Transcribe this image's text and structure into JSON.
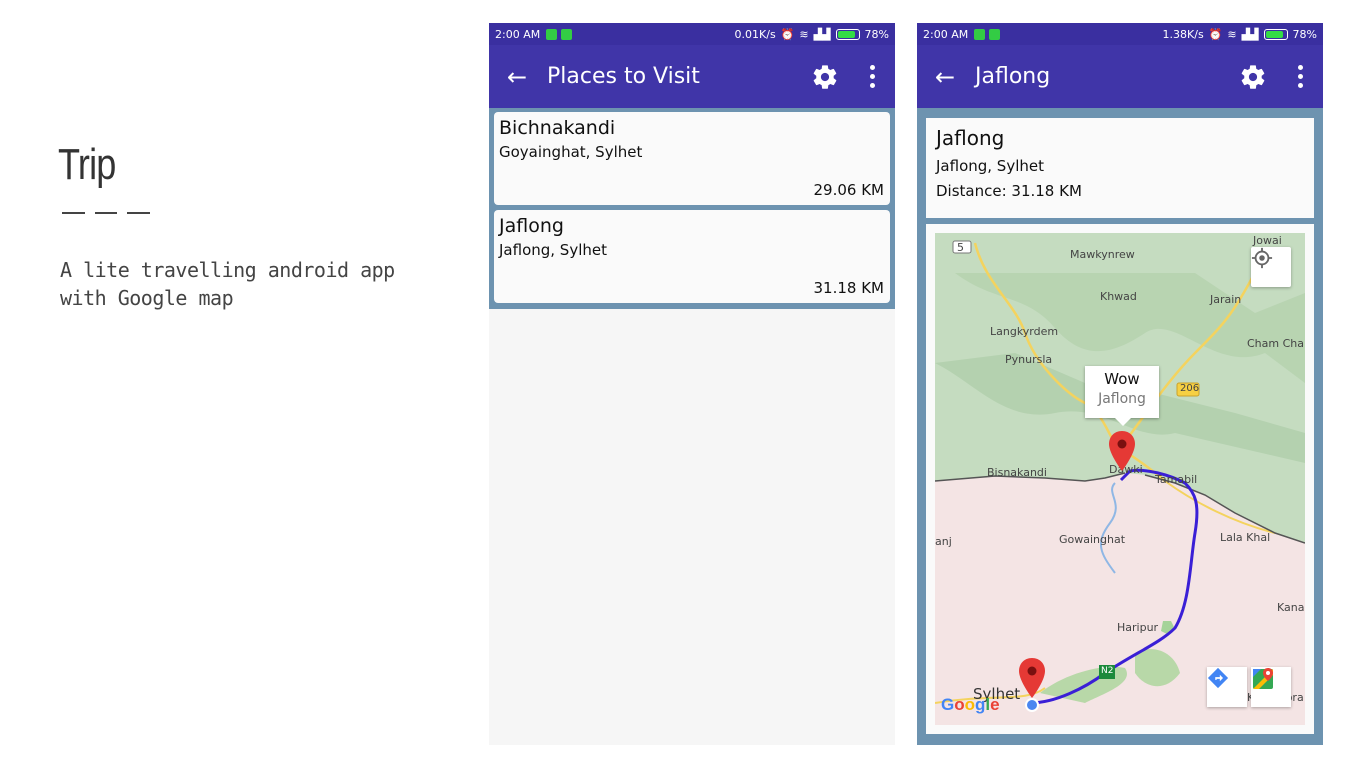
{
  "intro": {
    "title": "Trip",
    "description": "A lite travelling android app with Google map"
  },
  "phone1": {
    "status": {
      "time": "2:00 AM",
      "speed": "0.01K/s",
      "battery": "78%"
    },
    "appbar": {
      "title": "Places to Visit"
    },
    "places": [
      {
        "name": "Bichnakandi",
        "address": "Goyainghat, Sylhet",
        "distance": "29.06 KM"
      },
      {
        "name": "Jaflong",
        "address": "Jaflong, Sylhet",
        "distance": "31.18 KM"
      }
    ]
  },
  "phone2": {
    "status": {
      "time": "2:00 AM",
      "speed": "1.38K/s",
      "battery": "78%"
    },
    "appbar": {
      "title": "Jaflong"
    },
    "detail": {
      "name": "Jaflong",
      "address": "Jaflong, Sylhet",
      "distance": "Distance: 31.18 KM"
    },
    "map": {
      "info_title": "Wow",
      "info_subtitle": "Jaflong",
      "labels": {
        "road5": "5",
        "mawkynrew": "Mawkynrew",
        "jowai": "Jowai",
        "khwad": "Khwad",
        "jarain": "Jarain",
        "langkyrdem": "Langkyrdem",
        "chamcha": "Cham Cha",
        "pynursla": "Pynursla",
        "road206": "206",
        "dawki": "Dawki",
        "bisnakandi": "Bisnakandi",
        "tamabil": "Tamabil",
        "anj": "anj",
        "gowainghat": "Gowainghat",
        "lalakhal": "Lala Khal",
        "kanai": "Kanai",
        "haripur": "Haripur",
        "n2": "N2",
        "sylhet": "Sylhet",
        "kharavora": "Kharavora"
      },
      "google": [
        "G",
        "o",
        "o",
        "g",
        "l",
        "e"
      ]
    }
  },
  "colors": {
    "status_bar": "#3a2fa0",
    "app_bar": "#4035a8",
    "list_bg": "#6d93b0",
    "route": "#3a1fd6",
    "marker": "#e53935"
  },
  "icons": [
    "arrow-left-icon",
    "gear-icon",
    "more-vert-icon",
    "my-location-icon",
    "map-marker-icon",
    "directions-icon",
    "google-maps-icon"
  ]
}
